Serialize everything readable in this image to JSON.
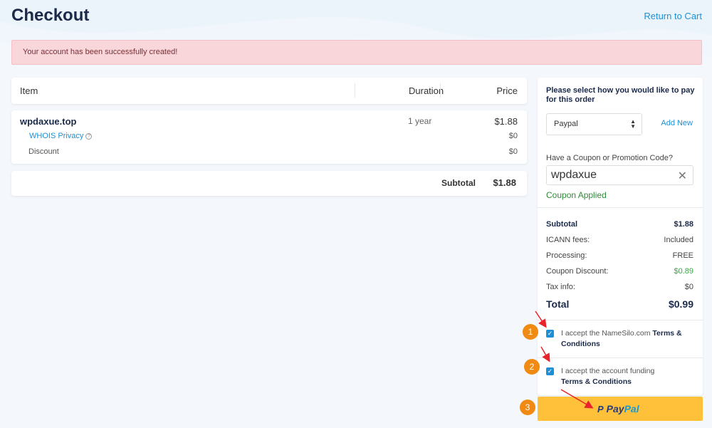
{
  "header": {
    "title": "Checkout",
    "return_link": "Return to Cart"
  },
  "alert": {
    "message": "Your account has been successfully created!"
  },
  "cart": {
    "columns": {
      "item": "Item",
      "duration": "Duration",
      "price": "Price"
    },
    "domain": {
      "name": "wpdaxue.top",
      "duration": "1 year",
      "price": "$1.88"
    },
    "whois": {
      "label": "WHOIS Privacy",
      "help": "?",
      "price": "$0"
    },
    "discount": {
      "label": "Discount",
      "price": "$0"
    },
    "subtotal": {
      "label": "Subtotal",
      "value": "$1.88"
    }
  },
  "payment": {
    "title": "Please select how you would like to pay for this order",
    "method_selected": "Paypal",
    "add_new": "Add New",
    "coupon_question": "Have a Coupon or Promotion Code?",
    "coupon_value": "wpdaxue",
    "coupon_status": "Coupon Applied"
  },
  "summary": {
    "subtotal": {
      "label": "Subtotal",
      "value": "$1.88"
    },
    "icann": {
      "label": "ICANN fees:",
      "value": "Included"
    },
    "processing": {
      "label": "Processing:",
      "value": "FREE"
    },
    "coupon_discount": {
      "label": "Coupon Discount:",
      "value": "$0.89"
    },
    "tax": {
      "label": "Tax info:",
      "value": "$0"
    },
    "total": {
      "label": "Total",
      "value": "$0.99"
    }
  },
  "terms": {
    "t1_prefix": "I accept the NameSilo.com",
    "t1_link": "Terms & Conditions",
    "t2_prefix": "I accept the account funding",
    "t2_link": "Terms & Conditions"
  },
  "paypal_button": {
    "part1": "Pay",
    "part2": "Pal"
  },
  "steps": [
    "1",
    "2",
    "3"
  ],
  "colors": {
    "accent": "#1e90d6",
    "alert_bg": "#f8d6da",
    "paypal": "#ffc03a",
    "step": "#f08a12"
  }
}
